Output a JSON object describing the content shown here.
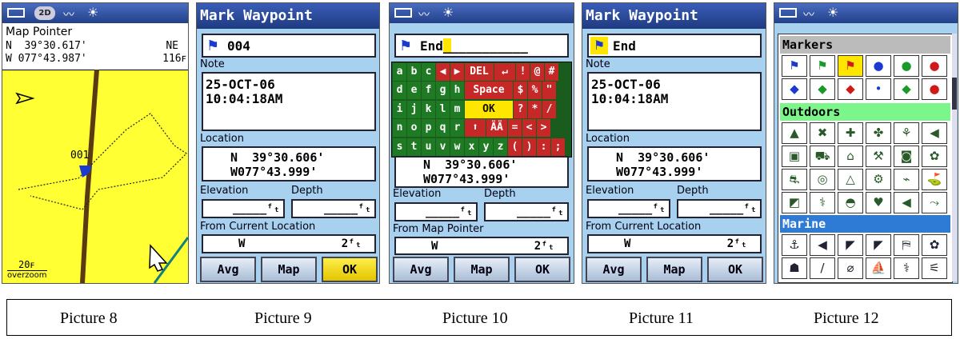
{
  "p8": {
    "title": "Map Pointer",
    "lat": "N  39°30.617'",
    "lon": "W 077°43.987'",
    "dir": "NE",
    "dist": "116ꜰ",
    "wp_label": "001",
    "scale": "20ꜰ",
    "zoom": "overzoom",
    "north": "N"
  },
  "p9": {
    "title": "Mark Waypoint",
    "name": "004",
    "note_label": "Note",
    "note_date": "25-OCT-06",
    "note_time": "10:04:18AM",
    "location_label": "Location",
    "loc_lat": "N  39°30.606'",
    "loc_lon": "W077°43.999'",
    "elev_label": "Elevation",
    "depth_label": "Depth",
    "elev_val": "_____ᶠₜ",
    "depth_val": "_____ᶠₜ",
    "from_label": "From Current Location",
    "from_dir": "W",
    "from_dist": "2ᶠₜ",
    "btn_avg": "Avg",
    "btn_map": "Map",
    "btn_ok": "OK"
  },
  "p10": {
    "name_entry": "End",
    "name_cursor": "_",
    "name_rest": "__________",
    "kb_rows": [
      [
        "a",
        "b",
        "c",
        "◀",
        "▶",
        "DEL",
        "↵",
        "!",
        "@",
        "#"
      ],
      [
        "d",
        "e",
        "f",
        "g",
        "h",
        "Space",
        "$",
        "%",
        "\""
      ],
      [
        "i",
        "j",
        "k",
        "l",
        "m",
        "OK",
        "?",
        "*",
        "/"
      ],
      [
        "n",
        "o",
        "p",
        "q",
        "r",
        "⬆",
        "ÄÄ",
        "=",
        "<",
        ">"
      ],
      [
        "s",
        "t",
        "u",
        "v",
        "w",
        "x",
        "y",
        "z",
        "(",
        ")",
        ":",
        ";"
      ]
    ],
    "loc_lat": "N  39°30.606'",
    "loc_lon": "W077°43.999'",
    "elev_label": "Elevation",
    "depth_label": "Depth",
    "elev_val": "_____ᶠₜ",
    "depth_val": "_____ᶠₜ",
    "from_label": "From Map Pointer",
    "from_dir": "W",
    "from_dist": "2ᶠₜ",
    "btn_avg": "Avg",
    "btn_map": "Map",
    "btn_ok": "OK"
  },
  "p11": {
    "title": "Mark Waypoint",
    "name": "End",
    "note_label": "Note",
    "note_date": "25-OCT-06",
    "note_time": "10:04:18AM",
    "location_label": "Location",
    "loc_lat": "N  39°30.606'",
    "loc_lon": "W077°43.999'",
    "elev_label": "Elevation",
    "depth_label": "Depth",
    "elev_val": "_____ᶠₜ",
    "depth_val": "_____ᶠₜ",
    "from_label": "From Current Location",
    "from_dir": "W",
    "from_dist": "2ᶠₜ",
    "btn_avg": "Avg",
    "btn_map": "Map",
    "btn_ok": "OK"
  },
  "p12": {
    "sec_markers": "Markers",
    "sec_outdoors": "Outdoors",
    "sec_marine": "Marine",
    "markers_row1": [
      "⚑",
      "⚑",
      "⚑",
      "●",
      "●",
      "●"
    ],
    "markers_row2": [
      "◆",
      "◆",
      "◆",
      "•",
      "◆",
      "●"
    ],
    "outdoor_row1": [
      "▲",
      "✖",
      "✚",
      "✤",
      "⚘",
      "◀"
    ],
    "outdoor_row2": [
      "▣",
      "⛟",
      "⌂",
      "⚒",
      "◙",
      "✿"
    ],
    "outdoor_row3": [
      "⛐",
      "◎",
      "△",
      "⚙",
      "⌁",
      "⛳"
    ],
    "outdoor_row4": [
      "◩",
      "⚕",
      "◓",
      "♥",
      "◀",
      "⤳"
    ],
    "marine_row1": [
      "⚓",
      "◀",
      "◤",
      "◤",
      "⛿",
      "✿"
    ],
    "marine_row2": [
      "☗",
      "/",
      "⌀",
      "⛵",
      "⚕",
      "⚟"
    ]
  },
  "captions": [
    "Picture 8",
    "Picture 9",
    "Picture 10",
    "Picture 11",
    "Picture 12"
  ],
  "colors": {
    "map_bg": "#ffff33",
    "panel_bg": "#a8d1f0",
    "title_bg": "#1e3a80",
    "kb_green": "#1f7a24",
    "kb_red": "#c62828",
    "sel_yellow": "#ffef4a",
    "outdoors_green": "#7cf58a",
    "marine_blue": "#2e7bd6"
  }
}
